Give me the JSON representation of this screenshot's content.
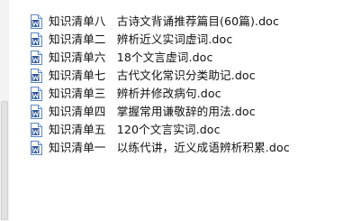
{
  "file_list": {
    "items": [
      {
        "name": "知识清单八   古诗文背诵推荐篇目(60篇).doc",
        "icon": "word-document-icon"
      },
      {
        "name": "知识清单二   辨析近义实词虚词.doc",
        "icon": "word-document-icon"
      },
      {
        "name": "知识清单六   18个文言虚词.doc",
        "icon": "word-document-icon"
      },
      {
        "name": "知识清单七   古代文化常识分类助记.doc",
        "icon": "word-document-icon"
      },
      {
        "name": "知识清单三   辨析并修改病句.doc",
        "icon": "word-document-icon"
      },
      {
        "name": "知识清单四   掌握常用谦敬辞的用法.doc",
        "icon": "word-document-icon"
      },
      {
        "name": "知识清单五   120个文言实词.doc",
        "icon": "word-document-icon"
      },
      {
        "name": "知识清单一   以练代讲，近义成语辨析积累.doc",
        "icon": "word-document-icon"
      }
    ]
  },
  "colors": {
    "icon_blue": "#2b5797",
    "icon_border": "#5b87c5",
    "text": "#111111",
    "background": "#ffffff"
  }
}
